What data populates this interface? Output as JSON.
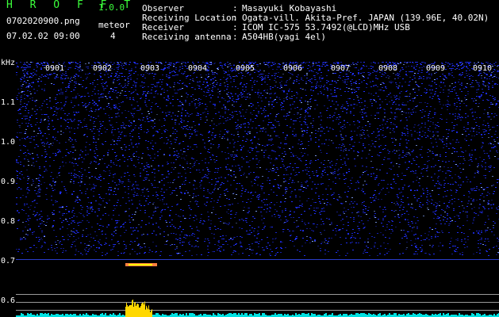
{
  "header": {
    "app_title": "H R O F F T",
    "app_version": "1.0.0",
    "filename": "0702020900.png",
    "datetime": "07.02.02 09:00",
    "meteor_label": "meteor",
    "meteor_count": "4",
    "info": [
      {
        "label": "Observer",
        "sep": ":",
        "value": "Masayuki Kobayashi"
      },
      {
        "label": "Receiving Location",
        "sep": ":",
        "value": "Ogata-vill. Akita-Pref. JAPAN (139.96E, 40.02N)"
      },
      {
        "label": "Receiver",
        "sep": ":",
        "value": "ICOM IC-575 53.7492(@LCD)MHz USB"
      },
      {
        "label": "Receiving antenna",
        "sep": ":",
        "value": "A504HB(yagi 4el)"
      }
    ]
  },
  "spectrogram": {
    "y_unit": "kHz",
    "y_labels": [
      "1.1",
      "1.0",
      "0.9",
      "0.8",
      "0.7",
      "0.6"
    ],
    "x_labels": [
      "0901",
      "0902",
      "0903",
      "0904",
      "0905",
      "0906",
      "0907",
      "0908",
      "0909",
      "0910"
    ],
    "colors": {
      "noise": "#2030ff",
      "bright": "#8aa8ff",
      "meteor": "#ffff00",
      "baseline": "#00e0e0",
      "burst": "#ffd800"
    }
  }
}
